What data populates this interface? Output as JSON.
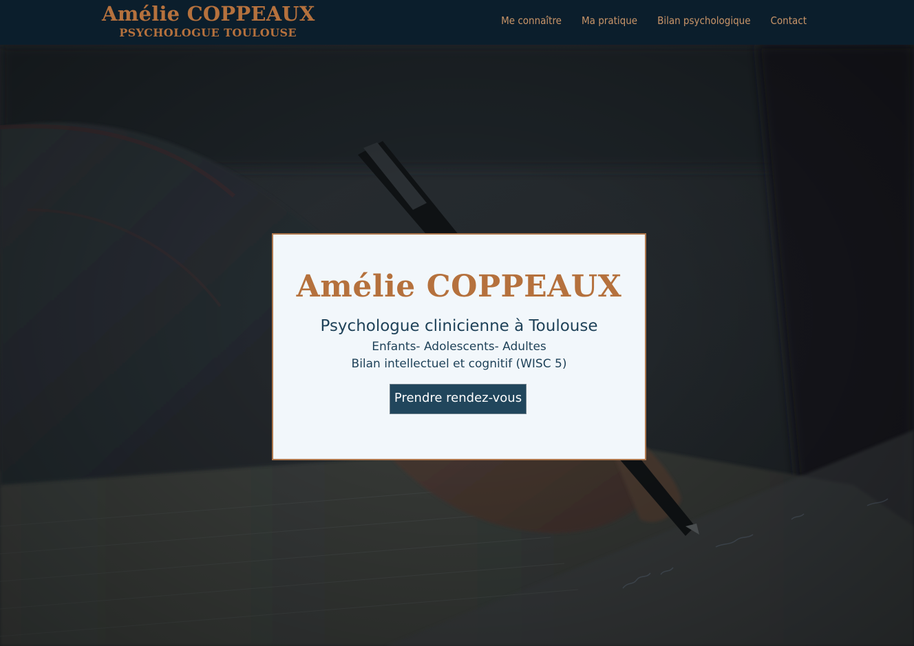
{
  "header": {
    "logo_name": "Amélie COPPEAUX",
    "logo_subtitle": "PSYCHOLOGUE TOULOUSE",
    "nav": [
      {
        "label": "Me connaître"
      },
      {
        "label": "Ma pratique"
      },
      {
        "label": "Bilan psychologique"
      },
      {
        "label": "Contact"
      }
    ]
  },
  "hero": {
    "title": "Amélie COPPEAUX",
    "subtitle": "Psychologue clinicienne à Toulouse",
    "line1": "Enfants- Adolescents- Adultes",
    "line2": "Bilan intellectuel et cognitif (WISC 5)",
    "cta_label": "Prendre rendez-vous"
  },
  "colors": {
    "header_bg": "#0b1e2c",
    "accent_copper": "#b5713d",
    "nav_text": "#c89468",
    "card_bg": "#f2f7fb",
    "card_border": "#b0784d",
    "heading_navy": "#1f4259",
    "button_bg": "#21465c"
  }
}
